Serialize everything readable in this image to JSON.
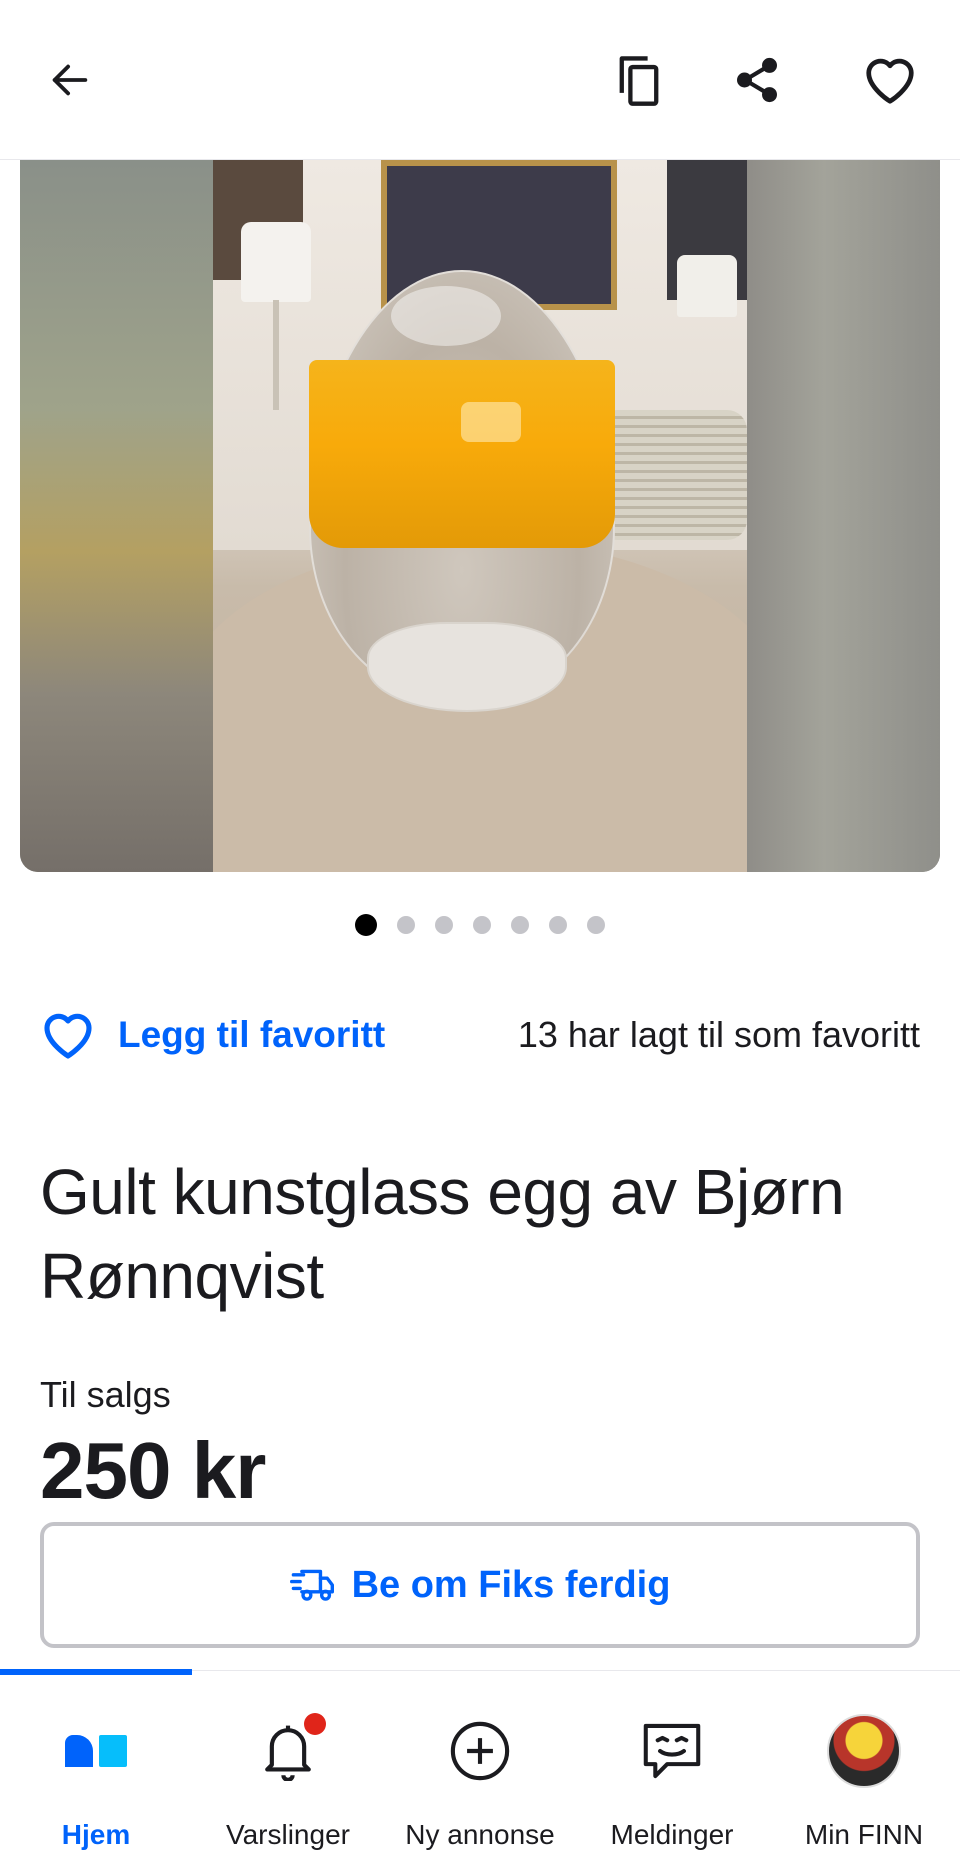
{
  "topbar": {
    "back_icon": "arrow-left-icon",
    "copy_icon": "copy-icon",
    "share_icon": "share-icon",
    "favorite_icon": "heart-outline-icon"
  },
  "gallery": {
    "image_count": 7,
    "active_index": 0
  },
  "favorite": {
    "link_label": "Legg til favoritt",
    "count_text": "13 har lagt til som favoritt"
  },
  "listing": {
    "title": "Gult kunstglass egg av Bjørn Rønnqvist",
    "sale_label": "Til salgs",
    "price": "250 kr"
  },
  "fiks_button": {
    "label": "Be om Fiks ferdig",
    "icon": "delivery-truck-icon"
  },
  "bottom_nav": {
    "items": [
      {
        "label": "Hjem",
        "icon": "home-icon",
        "active": true
      },
      {
        "label": "Varslinger",
        "icon": "bell-icon",
        "badge": true
      },
      {
        "label": "Ny annonse",
        "icon": "plus-circle-icon"
      },
      {
        "label": "Meldinger",
        "icon": "chat-icon"
      },
      {
        "label": "Min FINN",
        "icon": "avatar"
      }
    ]
  },
  "colors": {
    "accent": "#0063fb",
    "badge": "#e0251a",
    "text": "#1b1b1f"
  }
}
